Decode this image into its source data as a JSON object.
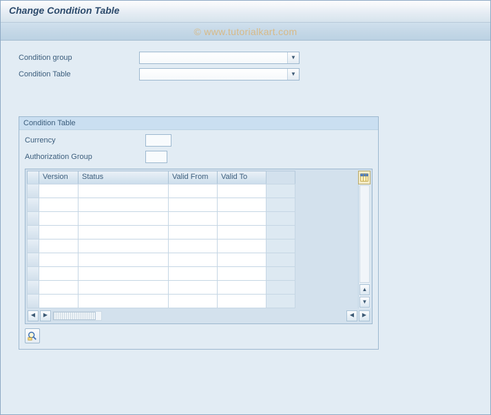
{
  "header": {
    "title": "Change Condition Table"
  },
  "watermark": "© www.tutorialkart.com",
  "fields": {
    "condition_group": {
      "label": "Condition group",
      "value": ""
    },
    "condition_table": {
      "label": "Condition Table",
      "value": ""
    }
  },
  "panel": {
    "title": "Condition Table",
    "currency": {
      "label": "Currency",
      "value": ""
    },
    "auth_group": {
      "label": "Authorization Group",
      "value": ""
    }
  },
  "table": {
    "columns": {
      "version": "Version",
      "status": "Status",
      "valid_from": "Valid From",
      "valid_to": "Valid To"
    },
    "rows": [
      {
        "version": "",
        "status": "",
        "valid_from": "",
        "valid_to": ""
      },
      {
        "version": "",
        "status": "",
        "valid_from": "",
        "valid_to": ""
      },
      {
        "version": "",
        "status": "",
        "valid_from": "",
        "valid_to": ""
      },
      {
        "version": "",
        "status": "",
        "valid_from": "",
        "valid_to": ""
      },
      {
        "version": "",
        "status": "",
        "valid_from": "",
        "valid_to": ""
      },
      {
        "version": "",
        "status": "",
        "valid_from": "",
        "valid_to": ""
      },
      {
        "version": "",
        "status": "",
        "valid_from": "",
        "valid_to": ""
      },
      {
        "version": "",
        "status": "",
        "valid_from": "",
        "valid_to": ""
      },
      {
        "version": "",
        "status": "",
        "valid_from": "",
        "valid_to": ""
      }
    ]
  },
  "icons": {
    "config": "table-settings-icon",
    "detail": "detail-view-icon"
  }
}
